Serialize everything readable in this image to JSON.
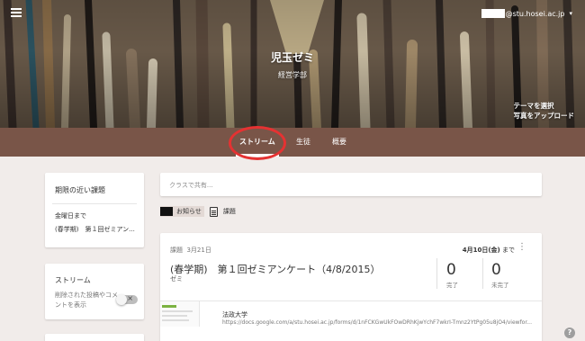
{
  "account": {
    "email_suffix": "@stu.hosei.ac.jp"
  },
  "class": {
    "title": "児玉ゼミ",
    "subtitle": "経営学部"
  },
  "theme": {
    "line1": "テーマを選択",
    "line2": "写真をアップロード"
  },
  "tabs": [
    {
      "label": "ストリーム",
      "active": true
    },
    {
      "label": "生徒",
      "active": false
    },
    {
      "label": "概要",
      "active": false
    }
  ],
  "sidebar": {
    "upcoming": {
      "title": "期限の近い課題",
      "due_label": "金曜日まで",
      "item": "(春学期)　第１回ゼミアン..."
    },
    "stream": {
      "title": "ストリーム",
      "desc_line1": "削除された投稿やコメ",
      "desc_line2": "ントを表示",
      "toggle_on": false
    }
  },
  "share": {
    "placeholder": "クラスで共有..."
  },
  "filters": [
    {
      "label": "お知らせ",
      "selected": true,
      "icon": "announcement-icon"
    },
    {
      "label": "課題",
      "selected": false,
      "icon": "assignment-icon"
    }
  ],
  "assignment": {
    "type": "課題",
    "date": "3月21日",
    "due": "4月10日(金)",
    "due_suffix": "まで",
    "title": "(春学期)　第１回ゼミアンケート（4/8/2015）",
    "subtitle": "ゼミ",
    "done_count": "0",
    "done_label": "完了",
    "notdone_count": "0",
    "notdone_label": "未完了",
    "attachment": {
      "name": "法政大学",
      "url": "https://docs.google.com/a/stu.hosei.ac.jp/forms/d/1nFCKGwUkFOwDRhKjwYchF7wkrI-Tmnz2YtPg05u8jO4/viewfor..."
    }
  },
  "colors": {
    "tab_bar": "#795548",
    "highlight_circle": "#e53232"
  }
}
